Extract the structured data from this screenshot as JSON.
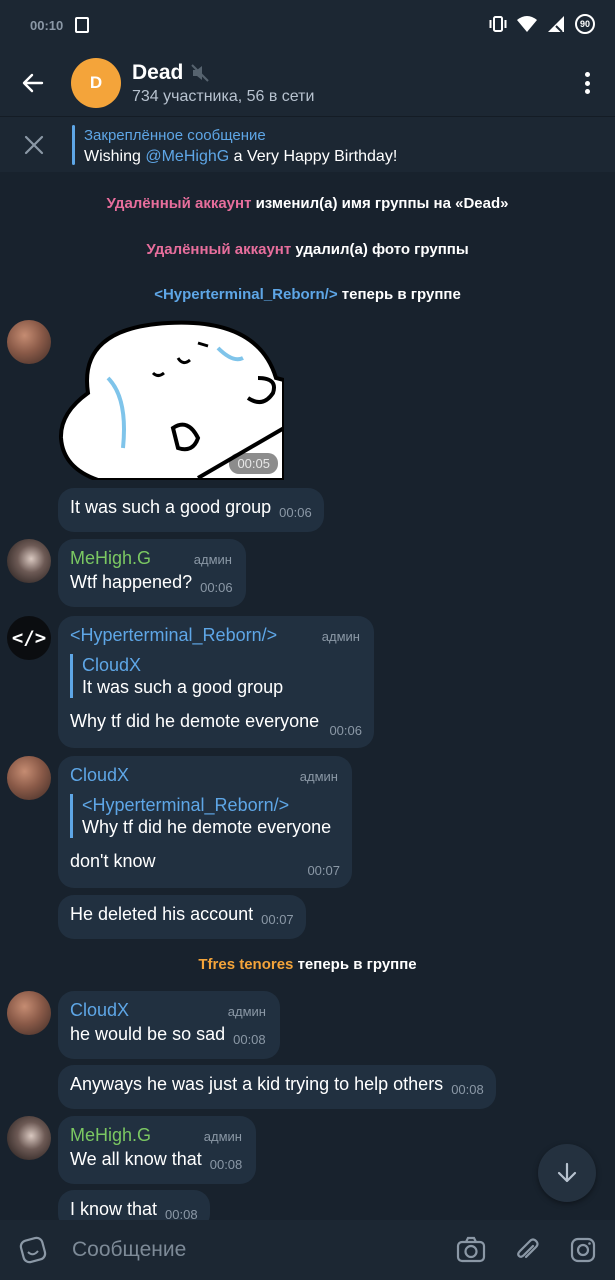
{
  "status_bar": {
    "time": "00:10",
    "battery": "90"
  },
  "header": {
    "avatar_letter": "D",
    "title": "Dead",
    "subtitle": "734 участника, 56 в сети"
  },
  "pinned": {
    "label": "Закреплённое сообщение",
    "text_before": "Wishing ",
    "mention": "@MeHighG",
    "text_after": " a Very Happy Birthday!"
  },
  "service_messages": [
    {
      "actor": "Удалённый аккаунт",
      "text": " изменил(а) имя группы на «Dead»"
    },
    {
      "actor": "Удалённый аккаунт",
      "text": " удалил(а) фото группы"
    },
    {
      "actor": "<Hyperterminal_Reborn/>",
      "text": " теперь в группе"
    },
    {
      "actor": "Tfres tenores",
      "text": " теперь в группе"
    }
  ],
  "sticker": {
    "time": "00:05"
  },
  "admin_label": "админ",
  "messages": [
    {
      "text": "It was such a good group",
      "time": "00:06"
    },
    {
      "sender": "MeHigh.G",
      "text": "Wtf happened?",
      "time": "00:06"
    },
    {
      "sender": "<Hyperterminal_Reborn/>",
      "quote_name": "CloudX",
      "quote_text": "It was such a good group",
      "text": "Why tf did he demote everyone",
      "time": "00:06"
    },
    {
      "sender": "CloudX",
      "quote_name": "<Hyperterminal_Reborn/>",
      "quote_text": "Why tf did he demote everyone",
      "text": "don't know",
      "time": "00:07"
    },
    {
      "text": "He deleted his account",
      "time": "00:07"
    },
    {
      "sender": "CloudX",
      "text": "he would be so sad",
      "time": "00:08"
    },
    {
      "text": "Anyways he was just a kid trying to help others",
      "time": "00:08"
    },
    {
      "sender": "MeHigh.G",
      "text": "We all know that",
      "time": "00:08"
    },
    {
      "text": "I know that",
      "time": "00:08"
    }
  ],
  "composer": {
    "placeholder": "Сообщение"
  },
  "code_avatar": "</>"
}
